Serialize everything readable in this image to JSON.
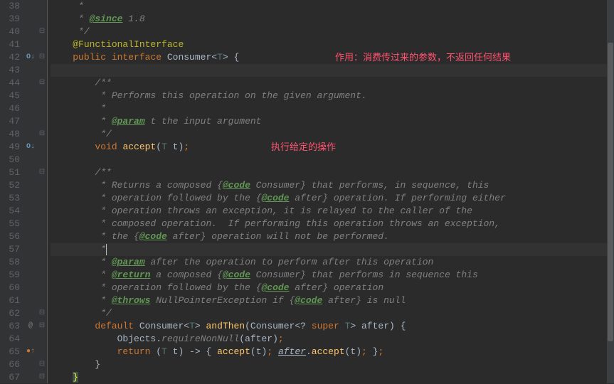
{
  "annotations": {
    "note1": "作用：消费传过来的参数，不返回任何结果",
    "note2": "执行给定的操作"
  },
  "lines": [
    {
      "n": "38",
      "fold": "",
      "marker": "",
      "tokens": [
        {
          "t": "     ",
          "c": ""
        },
        {
          "t": "*",
          "c": "comment"
        }
      ]
    },
    {
      "n": "39",
      "fold": "",
      "marker": "",
      "tokens": [
        {
          "t": "     ",
          "c": ""
        },
        {
          "t": "* ",
          "c": "comment"
        },
        {
          "t": "@since",
          "c": "doctag"
        },
        {
          "t": " 1.8",
          "c": "comment"
        }
      ]
    },
    {
      "n": "40",
      "fold": "⊟",
      "marker": "",
      "tokens": [
        {
          "t": "     ",
          "c": ""
        },
        {
          "t": "*/",
          "c": "comment"
        }
      ]
    },
    {
      "n": "41",
      "fold": "",
      "marker": "",
      "tokens": [
        {
          "t": "    ",
          "c": ""
        },
        {
          "t": "@FunctionalInterface",
          "c": "anno"
        }
      ]
    },
    {
      "n": "42",
      "fold": "⊟",
      "marker": "impl",
      "markerText": "O↓",
      "tokens": [
        {
          "t": "    ",
          "c": ""
        },
        {
          "t": "public interface ",
          "c": "kw"
        },
        {
          "t": "Consumer",
          "c": "type"
        },
        {
          "t": "<",
          "c": "brace"
        },
        {
          "t": "T",
          "c": "generic"
        },
        {
          "t": "> ",
          "c": "brace"
        },
        {
          "t": "{",
          "c": "brace"
        }
      ],
      "note": "note1",
      "notePos": "400"
    },
    {
      "n": "43",
      "fold": "",
      "marker": "",
      "hl": true,
      "tokens": []
    },
    {
      "n": "44",
      "fold": "⊟",
      "marker": "",
      "tokens": [
        {
          "t": "        ",
          "c": ""
        },
        {
          "t": "/**",
          "c": "comment"
        }
      ]
    },
    {
      "n": "45",
      "fold": "",
      "marker": "",
      "tokens": [
        {
          "t": "         ",
          "c": ""
        },
        {
          "t": "* Performs this operation on the given argument.",
          "c": "comment"
        }
      ]
    },
    {
      "n": "46",
      "fold": "",
      "marker": "",
      "tokens": [
        {
          "t": "         ",
          "c": ""
        },
        {
          "t": "*",
          "c": "comment"
        }
      ]
    },
    {
      "n": "47",
      "fold": "",
      "marker": "",
      "tokens": [
        {
          "t": "         ",
          "c": ""
        },
        {
          "t": "* ",
          "c": "comment"
        },
        {
          "t": "@param",
          "c": "doctag"
        },
        {
          "t": " t the input argument",
          "c": "comment"
        }
      ]
    },
    {
      "n": "48",
      "fold": "⊟",
      "marker": "",
      "tokens": [
        {
          "t": "         ",
          "c": ""
        },
        {
          "t": "*/",
          "c": "comment"
        }
      ]
    },
    {
      "n": "49",
      "fold": "",
      "marker": "impl",
      "markerText": "O↓",
      "tokens": [
        {
          "t": "        ",
          "c": ""
        },
        {
          "t": "void ",
          "c": "kw"
        },
        {
          "t": "accept",
          "c": "method"
        },
        {
          "t": "(",
          "c": "brace"
        },
        {
          "t": "T ",
          "c": "generic"
        },
        {
          "t": "t",
          "c": "param"
        },
        {
          "t": ")",
          "c": "brace"
        },
        {
          "t": ";",
          "c": "punct"
        }
      ],
      "note": "note2",
      "notePos": "310"
    },
    {
      "n": "50",
      "fold": "",
      "marker": "",
      "tokens": []
    },
    {
      "n": "51",
      "fold": "⊟",
      "marker": "",
      "tokens": [
        {
          "t": "        ",
          "c": ""
        },
        {
          "t": "/**",
          "c": "comment"
        }
      ]
    },
    {
      "n": "52",
      "fold": "",
      "marker": "",
      "tokens": [
        {
          "t": "         ",
          "c": ""
        },
        {
          "t": "* Returns a composed {",
          "c": "comment"
        },
        {
          "t": "@code",
          "c": "doctag"
        },
        {
          "t": " Consumer",
          "c": "comment"
        },
        {
          "t": "}",
          "c": "comment"
        },
        {
          "t": " that performs, in sequence, this",
          "c": "comment"
        }
      ]
    },
    {
      "n": "53",
      "fold": "",
      "marker": "",
      "tokens": [
        {
          "t": "         ",
          "c": ""
        },
        {
          "t": "* operation followed by the {",
          "c": "comment"
        },
        {
          "t": "@code",
          "c": "doctag"
        },
        {
          "t": " after",
          "c": "comment"
        },
        {
          "t": "}",
          "c": "comment"
        },
        {
          "t": " operation. If performing either",
          "c": "comment"
        }
      ]
    },
    {
      "n": "54",
      "fold": "",
      "marker": "",
      "tokens": [
        {
          "t": "         ",
          "c": ""
        },
        {
          "t": "* operation throws an exception, it is relayed to the caller of the",
          "c": "comment"
        }
      ]
    },
    {
      "n": "55",
      "fold": "",
      "marker": "",
      "tokens": [
        {
          "t": "         ",
          "c": ""
        },
        {
          "t": "* composed operation.  If performing this operation throws an exception,",
          "c": "comment"
        }
      ]
    },
    {
      "n": "56",
      "fold": "",
      "marker": "",
      "tokens": [
        {
          "t": "         ",
          "c": ""
        },
        {
          "t": "* the {",
          "c": "comment"
        },
        {
          "t": "@code",
          "c": "doctag"
        },
        {
          "t": " after",
          "c": "comment"
        },
        {
          "t": "}",
          "c": "comment"
        },
        {
          "t": " operation will not be performed.",
          "c": "comment"
        }
      ]
    },
    {
      "n": "57",
      "fold": "",
      "marker": "",
      "cur": true,
      "tokens": [
        {
          "t": "         ",
          "c": ""
        },
        {
          "t": "*",
          "c": "comment"
        }
      ],
      "caret": true
    },
    {
      "n": "58",
      "fold": "",
      "marker": "",
      "tokens": [
        {
          "t": "         ",
          "c": ""
        },
        {
          "t": "* ",
          "c": "comment"
        },
        {
          "t": "@param",
          "c": "doctag"
        },
        {
          "t": " after the operation to perform after this operation",
          "c": "comment"
        }
      ]
    },
    {
      "n": "59",
      "fold": "",
      "marker": "",
      "tokens": [
        {
          "t": "         ",
          "c": ""
        },
        {
          "t": "* ",
          "c": "comment"
        },
        {
          "t": "@return",
          "c": "doctag"
        },
        {
          "t": " a composed {",
          "c": "comment"
        },
        {
          "t": "@code",
          "c": "doctag"
        },
        {
          "t": " Consumer",
          "c": "comment"
        },
        {
          "t": "}",
          "c": "comment"
        },
        {
          "t": " that performs in sequence this",
          "c": "comment"
        }
      ]
    },
    {
      "n": "60",
      "fold": "",
      "marker": "",
      "tokens": [
        {
          "t": "         ",
          "c": ""
        },
        {
          "t": "* operation followed by the {",
          "c": "comment"
        },
        {
          "t": "@code",
          "c": "doctag"
        },
        {
          "t": " after",
          "c": "comment"
        },
        {
          "t": "}",
          "c": "comment"
        },
        {
          "t": " operation",
          "c": "comment"
        }
      ]
    },
    {
      "n": "61",
      "fold": "",
      "marker": "",
      "tokens": [
        {
          "t": "         ",
          "c": ""
        },
        {
          "t": "* ",
          "c": "comment"
        },
        {
          "t": "@throws",
          "c": "doctag"
        },
        {
          "t": " NullPointerException if {",
          "c": "comment"
        },
        {
          "t": "@code",
          "c": "doctag"
        },
        {
          "t": " after",
          "c": "comment"
        },
        {
          "t": "}",
          "c": "comment"
        },
        {
          "t": " is null",
          "c": "comment"
        }
      ]
    },
    {
      "n": "62",
      "fold": "⊟",
      "marker": "",
      "tokens": [
        {
          "t": "         ",
          "c": ""
        },
        {
          "t": "*/",
          "c": "comment"
        }
      ]
    },
    {
      "n": "63",
      "fold": "⊟",
      "marker": "at",
      "markerText": "@",
      "tokens": [
        {
          "t": "        ",
          "c": ""
        },
        {
          "t": "default ",
          "c": "kw"
        },
        {
          "t": "Consumer",
          "c": "type"
        },
        {
          "t": "<",
          "c": "brace"
        },
        {
          "t": "T",
          "c": "generic"
        },
        {
          "t": "> ",
          "c": "brace"
        },
        {
          "t": "andThen",
          "c": "method"
        },
        {
          "t": "(",
          "c": "brace"
        },
        {
          "t": "Consumer",
          "c": "type"
        },
        {
          "t": "<",
          "c": "brace"
        },
        {
          "t": "? ",
          "c": "brace"
        },
        {
          "t": "super ",
          "c": "kw"
        },
        {
          "t": "T",
          "c": "generic"
        },
        {
          "t": "> ",
          "c": "brace"
        },
        {
          "t": "after",
          "c": "param"
        },
        {
          "t": ") ",
          "c": "brace"
        },
        {
          "t": "{",
          "c": "brace"
        }
      ]
    },
    {
      "n": "64",
      "fold": "",
      "marker": "",
      "tokens": [
        {
          "t": "            ",
          "c": ""
        },
        {
          "t": "Objects.",
          "c": "type"
        },
        {
          "t": "requireNonNull",
          "c": "comment"
        },
        {
          "t": "(",
          "c": "brace"
        },
        {
          "t": "after",
          "c": "param"
        },
        {
          "t": ")",
          "c": "brace"
        },
        {
          "t": ";",
          "c": "punct"
        }
      ]
    },
    {
      "n": "65",
      "fold": "",
      "marker": "override",
      "markerText": "●↑",
      "tokens": [
        {
          "t": "            ",
          "c": ""
        },
        {
          "t": "return ",
          "c": "kw"
        },
        {
          "t": "(",
          "c": "brace"
        },
        {
          "t": "T ",
          "c": "generic"
        },
        {
          "t": "t",
          "c": "param"
        },
        {
          "t": ") -> ",
          "c": "brace"
        },
        {
          "t": "{ ",
          "c": "brace"
        },
        {
          "t": "accept",
          "c": "method"
        },
        {
          "t": "(",
          "c": "brace"
        },
        {
          "t": "t",
          "c": "param"
        },
        {
          "t": ")",
          "c": "brace"
        },
        {
          "t": "; ",
          "c": "punct"
        },
        {
          "t": "after",
          "c": "ital-id"
        },
        {
          "t": ".",
          "c": "brace"
        },
        {
          "t": "accept",
          "c": "method"
        },
        {
          "t": "(",
          "c": "brace"
        },
        {
          "t": "t",
          "c": "param"
        },
        {
          "t": ")",
          "c": "brace"
        },
        {
          "t": "; ",
          "c": "punct"
        },
        {
          "t": "}",
          "c": "brace"
        },
        {
          "t": ";",
          "c": "punct"
        }
      ]
    },
    {
      "n": "66",
      "fold": "⊟",
      "marker": "",
      "tokens": [
        {
          "t": "        ",
          "c": ""
        },
        {
          "t": "}",
          "c": "brace"
        }
      ]
    },
    {
      "n": "67",
      "fold": "⊟",
      "marker": "",
      "tokens": [
        {
          "t": "    ",
          "c": ""
        },
        {
          "t": "}",
          "c": "brace-hl"
        }
      ]
    }
  ],
  "scrollbar": {
    "thumbTop": 60,
    "thumbHeight": 420
  }
}
